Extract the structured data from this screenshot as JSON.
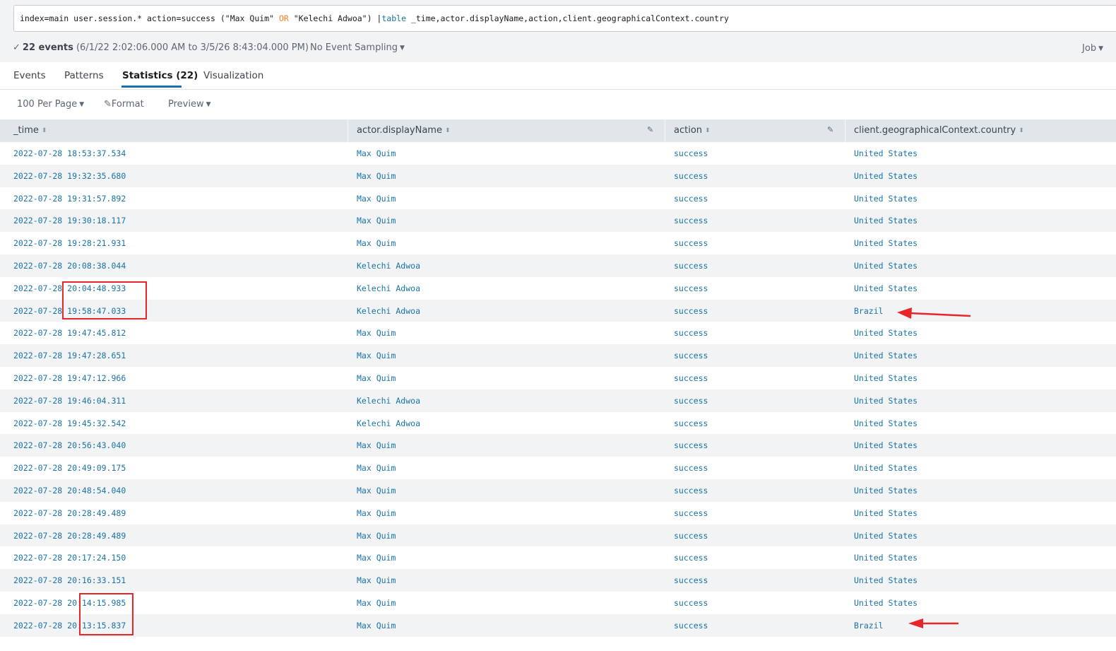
{
  "search": {
    "part1": "index=main user.session.* action=success (\"Max Quim\" ",
    "or": "OR",
    "part2": " \"Kelechi Adwoa\") |",
    "cmd": "table",
    "part3": " _time,actor.displayName,action,client.geographicalContext.country"
  },
  "status": {
    "check": "✓",
    "count": "22 events",
    "range": " (6/1/22 2:02:06.000 AM to 3/5/26 8:43:04.000 PM)",
    "sampling": "No Event Sampling",
    "job": "Job"
  },
  "tabs": [
    {
      "label": "Events"
    },
    {
      "label": "Patterns"
    },
    {
      "label": "Statistics (22)"
    },
    {
      "label": "Visualization"
    }
  ],
  "toolbar": {
    "per_page": "100 Per Page",
    "format": "Format",
    "preview": "Preview"
  },
  "table": {
    "columns": [
      "_time",
      "actor.displayName",
      "action",
      "client.geographicalContext.country"
    ],
    "rows": [
      [
        "2022-07-28 18:53:37.534",
        "Max Quim",
        "success",
        "United States"
      ],
      [
        "2022-07-28 19:32:35.680",
        "Max Quim",
        "success",
        "United States"
      ],
      [
        "2022-07-28 19:31:57.892",
        "Max Quim",
        "success",
        "United States"
      ],
      [
        "2022-07-28 19:30:18.117",
        "Max Quim",
        "success",
        "United States"
      ],
      [
        "2022-07-28 19:28:21.931",
        "Max Quim",
        "success",
        "United States"
      ],
      [
        "2022-07-28 20:08:38.044",
        "Kelechi Adwoa",
        "success",
        "United States"
      ],
      [
        "2022-07-28 20:04:48.933",
        "Kelechi Adwoa",
        "success",
        "United States"
      ],
      [
        "2022-07-28 19:58:47.033",
        "Kelechi Adwoa",
        "success",
        "Brazil"
      ],
      [
        "2022-07-28 19:47:45.812",
        "Max Quim",
        "success",
        "United States"
      ],
      [
        "2022-07-28 19:47:28.651",
        "Max Quim",
        "success",
        "United States"
      ],
      [
        "2022-07-28 19:47:12.966",
        "Max Quim",
        "success",
        "United States"
      ],
      [
        "2022-07-28 19:46:04.311",
        "Kelechi Adwoa",
        "success",
        "United States"
      ],
      [
        "2022-07-28 19:45:32.542",
        "Kelechi Adwoa",
        "success",
        "United States"
      ],
      [
        "2022-07-28 20:56:43.040",
        "Max Quim",
        "success",
        "United States"
      ],
      [
        "2022-07-28 20:49:09.175",
        "Max Quim",
        "success",
        "United States"
      ],
      [
        "2022-07-28 20:48:54.040",
        "Max Quim",
        "success",
        "United States"
      ],
      [
        "2022-07-28 20:28:49.489",
        "Max Quim",
        "success",
        "United States"
      ],
      [
        "2022-07-28 20:28:49.489",
        "Max Quim",
        "success",
        "United States"
      ],
      [
        "2022-07-28 20:17:24.150",
        "Max Quim",
        "success",
        "United States"
      ],
      [
        "2022-07-28 20:16:33.151",
        "Max Quim",
        "success",
        "United States"
      ],
      [
        "2022-07-28 20:14:15.985",
        "Max Quim",
        "success",
        "United States"
      ],
      [
        "2022-07-28 20:13:15.837",
        "Max Quim",
        "success",
        "Brazil"
      ]
    ]
  },
  "annotations": {
    "color": "#e8262a"
  },
  "colors": {
    "link": "#1a73a8",
    "or_keyword": "#f58220",
    "tab_active": "#1a73a8"
  }
}
